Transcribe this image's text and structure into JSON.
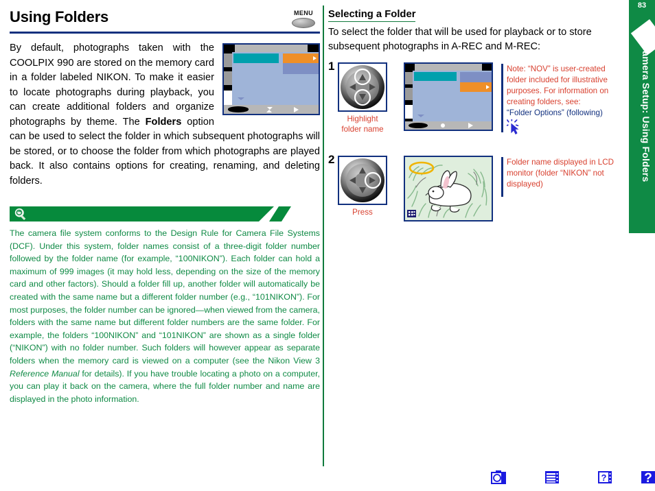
{
  "page": {
    "number": "83"
  },
  "header": {
    "title": "Using Folders",
    "menu_label": "MENU",
    "menu_icon": "menu-button-icon"
  },
  "left_column": {
    "intro_part1": "By default, photographs taken with the COOLPIX 990 are stored on the memory card in a folder labeled NIKON. To make it easier to locate photographs during playback, you can create additional folders and organize photographs by theme. The ",
    "intro_bold": "Folders",
    "intro_part2": " option can be used to select the folder in which subsequent photographs will be stored, or to choose the folder from which photographs are played back.  It also contains options for creating, renaming, and deleting folders.",
    "tip": {
      "icon": "lightbulb-tip-icon",
      "text_a": "The camera file system conforms to the Design Rule for Camera File Systems (DCF).  Under this system, folder names consist of a three-digit folder number followed by the folder name (for example, “100NIKON”).  Each folder can hold a maximum of 999 images (it may hold less, depending on the size of the memory card and other factors).  Should a folder fill up, another folder will automatically be created with the same name but a different folder number (e.g., “101NIKON”).  For most purposes, the folder number can be ignored—when viewed from the camera, folders with the same name but different folder numbers are the same folder.  For example, the folders “100NIKON” and “101NIKON” are shown as a single folder (“NIKON”) with no folder number.  Such folders will however appear as separate folders when the memory card is viewed on a computer (see the Nikon View 3 ",
      "text_italic": "Reference Manual",
      "text_b": " for details).  If you have trouble locating a photo on a computer, you can play it back on the camera, where the full folder number and name are displayed in the photo information."
    }
  },
  "right_column": {
    "heading": "Selecting a Folder",
    "intro": "To select the folder that will be used for playback or to store subsequent photographs in A-REC and M-REC:",
    "steps": [
      {
        "number": "1",
        "dial_icon": "multi-selector-up-down-icon",
        "caption": "Highlight\nfolder name",
        "screen_icon": "lcd-folder-menu-screen"
      },
      {
        "number": "2",
        "dial_icon": "multi-selector-right-icon",
        "caption": "Press",
        "screen_icon": "lcd-rabbit-photo"
      }
    ],
    "note1": {
      "line1": "Note: “NOV” is user-created",
      "line2": "folder included for illustrative",
      "line3": "purposes.  For information on",
      "line4": "creating folders, see:",
      "link": "“Folder Options” (following)",
      "cursor_icon": "click-cursor-icon"
    },
    "note2": {
      "line1": "Folder name displayed in LCD",
      "line2": "monitor (folder “NIKON” not",
      "line3": "displayed)"
    }
  },
  "side_tab": {
    "page_number": "83",
    "label": "Camera Setup: Using Folders"
  },
  "footer": {
    "icons": [
      {
        "name": "camera-icon"
      },
      {
        "name": "menu-list-icon"
      },
      {
        "name": "help-index-icon"
      },
      {
        "name": "question-mark-icon"
      }
    ]
  },
  "colors": {
    "accent_green": "#0f8a45",
    "accent_blue": "#11307e",
    "note_red": "#d8402f",
    "lcd_teal": "#00a0ad",
    "lcd_orange": "#ef8f28",
    "lcd_field": "#9fb4d8",
    "lcd_slate": "#7e8fc4"
  }
}
